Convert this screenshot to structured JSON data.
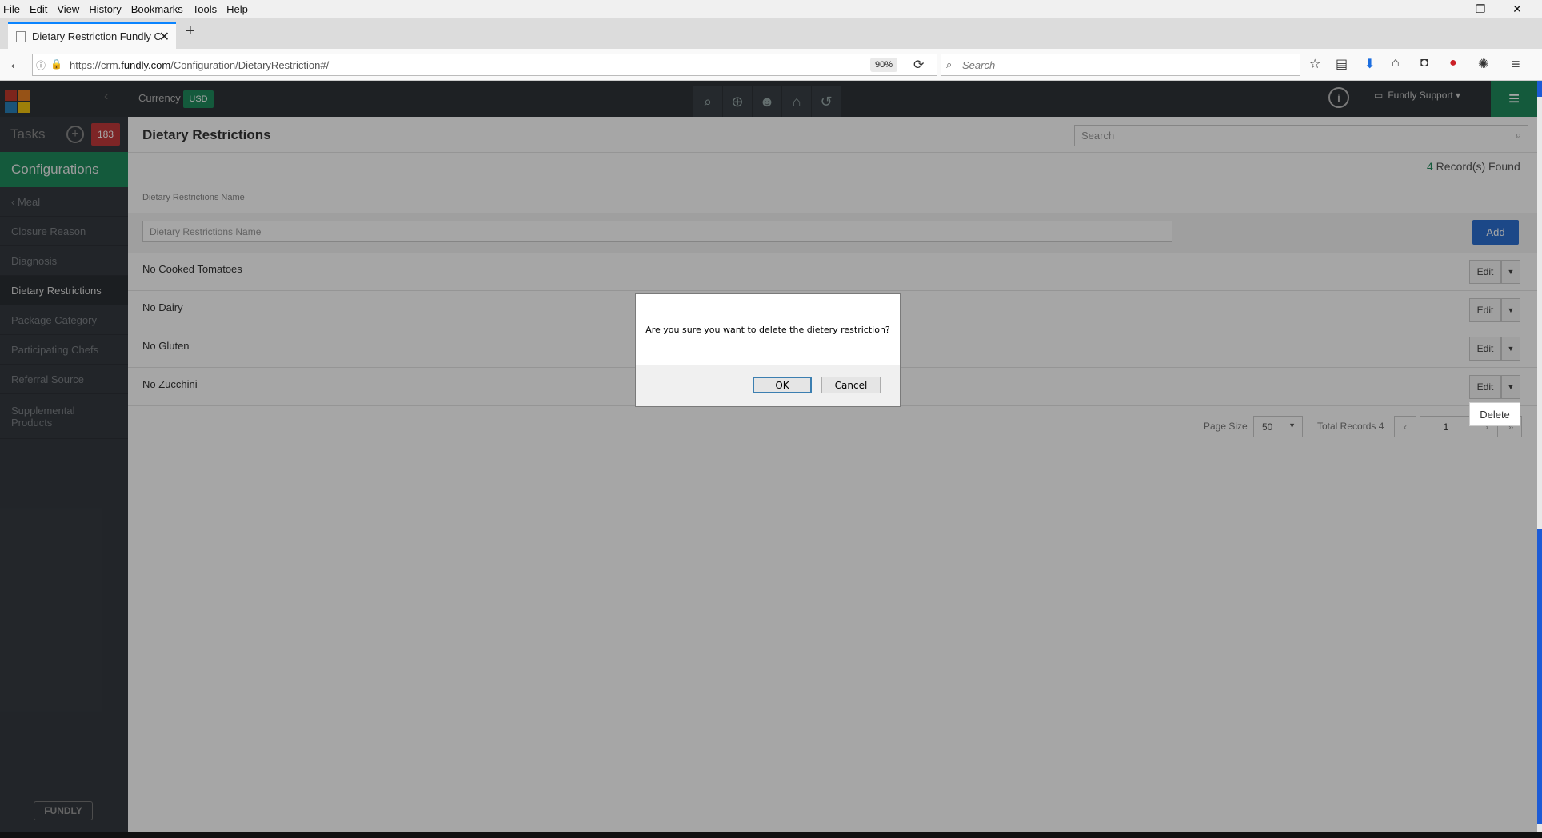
{
  "browser": {
    "menu": [
      "File",
      "Edit",
      "View",
      "History",
      "Bookmarks",
      "Tools",
      "Help"
    ],
    "tab_title": "Dietary Restriction Fundly C",
    "url_prefix": "https://crm.",
    "url_domain": "fundly.com",
    "url_path": "/Configuration/DietaryRestriction#/",
    "zoom": "90%",
    "search_placeholder": "Search",
    "window_controls": [
      "–",
      "❐",
      "✕"
    ]
  },
  "header": {
    "currency_label": "Currency",
    "currency_value": "USD",
    "user_menu": "Fundly Support ▾",
    "info_glyph": "i",
    "colors": {
      "accent": "#1f8a5c",
      "header_bg": "#2f3338"
    }
  },
  "sidebar": {
    "tasks_label": "Tasks",
    "tasks_count": "183",
    "section_title": "Configurations",
    "back_item": "‹  Meal",
    "items": [
      {
        "label": "Closure Reason"
      },
      {
        "label": "Diagnosis"
      },
      {
        "label": "Dietary Restrictions",
        "active": true
      },
      {
        "label": "Package Category"
      },
      {
        "label": "Participating Chefs"
      },
      {
        "label": "Referral Source"
      },
      {
        "label": "Supplemental Products"
      }
    ],
    "footer_logo": "FUNDLY"
  },
  "main": {
    "title": "Dietary Restrictions",
    "search_placeholder": "Search",
    "records_count": "4",
    "records_label": " Record(s) Found",
    "column_header": "Dietary Restrictions Name",
    "filter_placeholder": "Dietary Restrictions Name",
    "add_label": "Add",
    "rows": [
      {
        "name": "No Cooked Tomatoes",
        "edit": "Edit"
      },
      {
        "name": "No Dairy",
        "edit": "Edit"
      },
      {
        "name": "No Gluten",
        "edit": "Edit"
      },
      {
        "name": "No Zucchini",
        "edit": "Edit"
      }
    ],
    "row_menu_item": "Delete",
    "pagination": {
      "page_size_label": "Page Size",
      "page_size": "50",
      "total_label": "Total Records 4",
      "prev": "‹",
      "page": "1",
      "next": "›",
      "last": "»"
    }
  },
  "dialog": {
    "message": "Are you sure you want to delete the dietery restriction?",
    "ok_label": "OK",
    "cancel_label": "Cancel"
  }
}
